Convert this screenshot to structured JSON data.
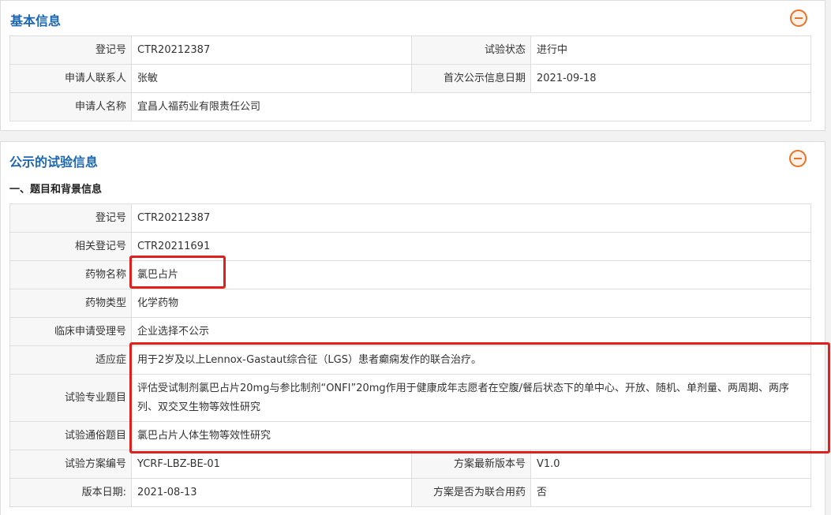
{
  "basic_panel": {
    "title": "基本信息",
    "rows": [
      {
        "k1": "登记号",
        "v1": "CTR20212387",
        "k2": "试验状态",
        "v2": "进行中"
      },
      {
        "k1": "申请人联系人",
        "v1": "张敏",
        "k2": "首次公示信息日期",
        "v2": "2021-09-18"
      },
      {
        "k1": "申请人名称",
        "v1": "宜昌人福药业有限责任公司"
      }
    ]
  },
  "public_panel": {
    "title": "公示的试验信息",
    "section_heading": "一、题目和背景信息",
    "rows": [
      {
        "k": "登记号",
        "v": "CTR20212387"
      },
      {
        "k": "相关登记号",
        "v": "CTR20211691"
      },
      {
        "k": "药物名称",
        "v": "氯巴占片"
      },
      {
        "k": "药物类型",
        "v": "化学药物"
      },
      {
        "k": "临床申请受理号",
        "v": "企业选择不公示"
      },
      {
        "k": "适应症",
        "v": "用于2岁及以上Lennox-Gastaut综合征（LGS）患者癫痫发作的联合治疗。"
      },
      {
        "k": "试验专业题目",
        "v": "评估受试制剂氯巴占片20mg与参比制剂“ONFI”20mg作用于健康成年志愿者在空腹/餐后状态下的单中心、开放、随机、单剂量、两周期、两序列、双交叉生物等效性研究"
      },
      {
        "k": "试验通俗题目",
        "v": "氯巴占片人体生物等效性研究"
      }
    ],
    "pair_rows": [
      {
        "k1": "试验方案编号",
        "v1": "YCRF-LBZ-BE-01",
        "k2": "方案最新版本号",
        "v2": "V1.0"
      },
      {
        "k1": "版本日期:",
        "v1": "2021-08-13",
        "k2": "方案是否为联合用药",
        "v2": "否"
      }
    ]
  },
  "colors": {
    "title_blue": "#1a66b3",
    "collapse_orange": "#e8742a",
    "highlight_red": "#e0201d"
  },
  "icons": {
    "collapse": "minus-circle-icon"
  }
}
